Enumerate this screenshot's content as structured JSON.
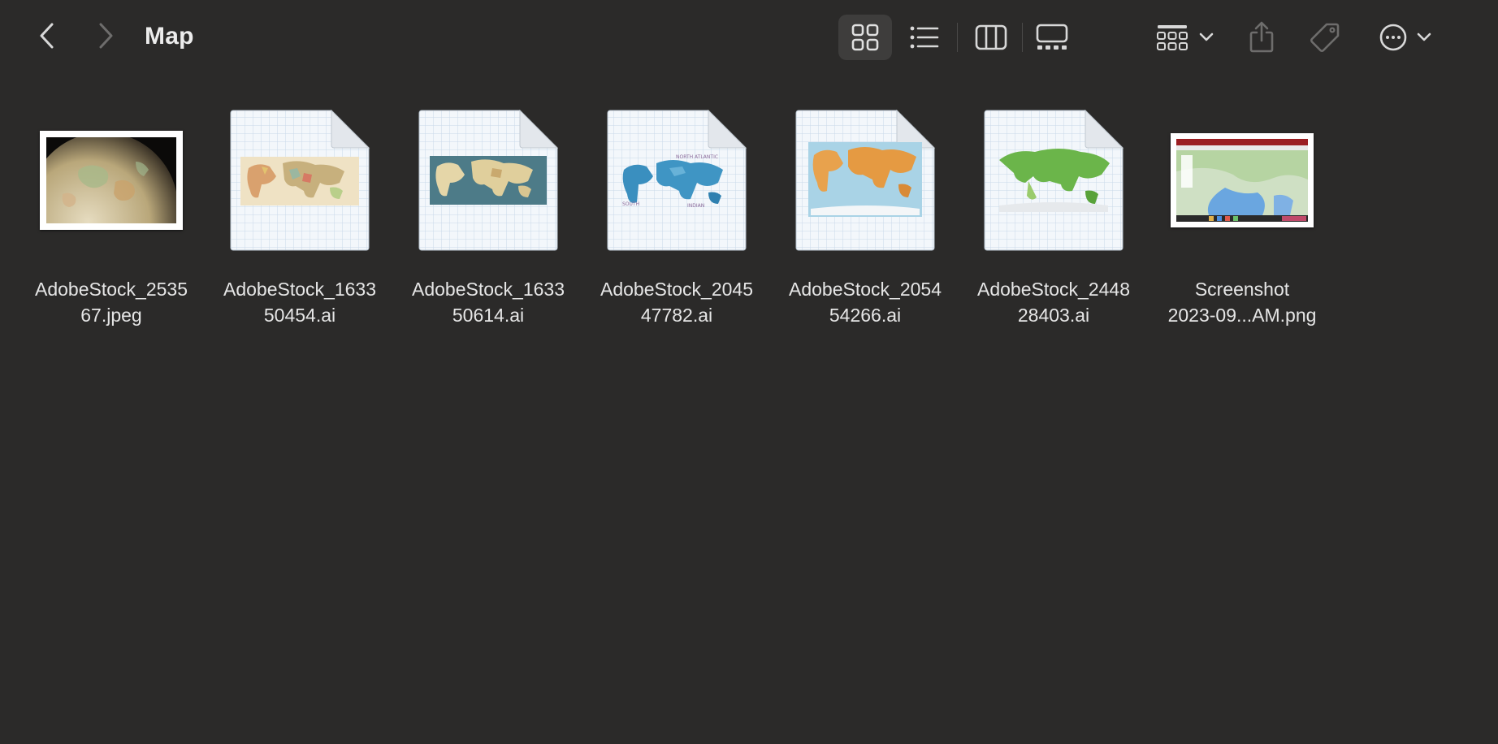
{
  "window": {
    "title": "Map"
  },
  "toolbar": {
    "view_modes": [
      {
        "name": "icon-view",
        "selected": true
      },
      {
        "name": "list-view",
        "selected": false
      },
      {
        "name": "column-view",
        "selected": false
      },
      {
        "name": "gallery-view",
        "selected": false
      }
    ],
    "icons": [
      "chevron-left-icon",
      "chevron-right-icon",
      "grid-icon",
      "list-icon",
      "columns-icon",
      "gallery-icon",
      "group-icon",
      "chevron-down-icon",
      "share-icon",
      "tag-icon",
      "ellipsis-circle-icon"
    ]
  },
  "files": [
    {
      "line1": "AdobeStock_2535",
      "line2": "67.jpeg",
      "kind": "photo",
      "preview": "globe"
    },
    {
      "line1": "AdobeStock_1633",
      "line2": "50454.ai",
      "kind": "ai",
      "preview": "vintage-map"
    },
    {
      "line1": "AdobeStock_1633",
      "line2": "50614.ai",
      "kind": "ai",
      "preview": "teal-map"
    },
    {
      "line1": "AdobeStock_2045",
      "line2": "47782.ai",
      "kind": "ai",
      "preview": "blue-map"
    },
    {
      "line1": "AdobeStock_2054",
      "line2": "54266.ai",
      "kind": "ai",
      "preview": "orange-map"
    },
    {
      "line1": "AdobeStock_2448",
      "line2": "28403.ai",
      "kind": "ai",
      "preview": "green-map"
    },
    {
      "line1": "Screenshot",
      "line2": "2023-09...AM.png",
      "kind": "photo",
      "preview": "screenshot"
    }
  ],
  "colors": {
    "background": "#2b2a29",
    "selected_view": "#3e3d3c",
    "icon_active": "#d8d8d8",
    "icon_dim": "#6e6d6c"
  }
}
